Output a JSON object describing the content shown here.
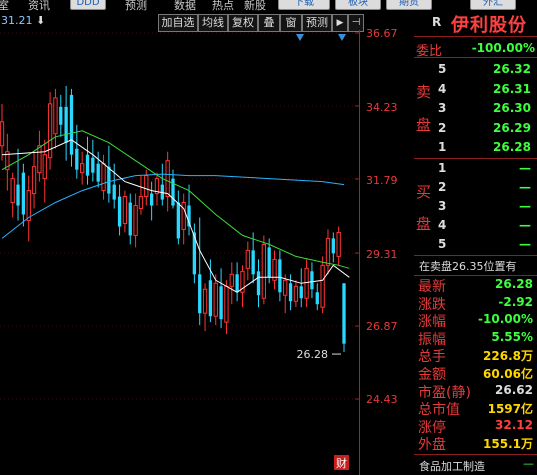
{
  "topbar": {
    "items": [
      "室",
      "资讯"
    ],
    "buttons": [
      "DDD",
      "预测",
      "数据",
      "热点",
      "新股",
      "下载",
      "板块",
      "期货",
      "外汇"
    ]
  },
  "price_label": "31.21",
  "arrow_glyph": "⬇",
  "toolbar": {
    "buttons": [
      "加自选",
      "均线",
      "复权",
      "叠",
      "窗",
      "预测"
    ],
    "play": "▶",
    "pin": "⊣"
  },
  "chart_data": {
    "type": "candlestick",
    "title": "",
    "y_ticks": [
      36.67,
      34.23,
      31.79,
      29.31,
      26.87,
      24.43
    ],
    "ylim": [
      22.7,
      37.1
    ],
    "last_close_label": "26.28",
    "bottom_marker": "财",
    "colors": {
      "up": "#ff3333",
      "down": "#28d8ff",
      "ma_short": "#ffffff",
      "ma_mid": "#3cdc3c",
      "ma_long": "#28b4ff",
      "axis": "#b01e1e"
    },
    "candles": [
      {
        "o": 32.9,
        "h": 34.3,
        "l": 32.4,
        "c": 33.7
      },
      {
        "o": 32.1,
        "h": 33.3,
        "l": 31.4,
        "c": 32.7
      },
      {
        "o": 31.0,
        "h": 32.0,
        "l": 30.5,
        "c": 31.8
      },
      {
        "o": 31.6,
        "h": 32.8,
        "l": 30.4,
        "c": 30.9
      },
      {
        "o": 32.0,
        "h": 32.3,
        "l": 30.2,
        "c": 30.6
      },
      {
        "o": 30.4,
        "h": 31.9,
        "l": 29.7,
        "c": 31.4
      },
      {
        "o": 31.3,
        "h": 32.7,
        "l": 30.8,
        "c": 32.2
      },
      {
        "o": 32.0,
        "h": 33.4,
        "l": 31.7,
        "c": 32.9
      },
      {
        "o": 31.8,
        "h": 33.1,
        "l": 31.0,
        "c": 32.6
      },
      {
        "o": 32.5,
        "h": 34.7,
        "l": 32.1,
        "c": 34.3
      },
      {
        "o": 33.3,
        "h": 34.8,
        "l": 32.8,
        "c": 34.5
      },
      {
        "o": 34.2,
        "h": 34.6,
        "l": 33.2,
        "c": 33.6
      },
      {
        "o": 34.2,
        "h": 34.9,
        "l": 32.4,
        "c": 33.0
      },
      {
        "o": 34.6,
        "h": 34.8,
        "l": 32.2,
        "c": 32.6
      },
      {
        "o": 32.8,
        "h": 33.6,
        "l": 31.8,
        "c": 32.1
      },
      {
        "o": 32.0,
        "h": 32.7,
        "l": 31.6,
        "c": 32.3
      },
      {
        "o": 32.6,
        "h": 33.2,
        "l": 31.6,
        "c": 31.9
      },
      {
        "o": 32.5,
        "h": 33.1,
        "l": 31.7,
        "c": 32.0
      },
      {
        "o": 32.3,
        "h": 32.7,
        "l": 31.5,
        "c": 31.7
      },
      {
        "o": 31.4,
        "h": 32.6,
        "l": 31.1,
        "c": 32.3
      },
      {
        "o": 32.2,
        "h": 32.9,
        "l": 31.0,
        "c": 31.3
      },
      {
        "o": 31.6,
        "h": 32.3,
        "l": 30.8,
        "c": 31.1
      },
      {
        "o": 31.2,
        "h": 31.6,
        "l": 29.9,
        "c": 30.2
      },
      {
        "o": 30.3,
        "h": 31.4,
        "l": 30.0,
        "c": 31.2
      },
      {
        "o": 31.0,
        "h": 31.3,
        "l": 29.6,
        "c": 29.9
      },
      {
        "o": 29.9,
        "h": 31.3,
        "l": 29.5,
        "c": 30.9
      },
      {
        "o": 30.8,
        "h": 31.9,
        "l": 30.6,
        "c": 31.2
      },
      {
        "o": 31.2,
        "h": 32.1,
        "l": 30.9,
        "c": 31.9
      },
      {
        "o": 31.3,
        "h": 31.7,
        "l": 30.4,
        "c": 30.9
      },
      {
        "o": 31.3,
        "h": 32.0,
        "l": 30.9,
        "c": 31.8
      },
      {
        "o": 31.6,
        "h": 32.3,
        "l": 30.9,
        "c": 31.1
      },
      {
        "o": 31.2,
        "h": 32.7,
        "l": 30.7,
        "c": 32.4
      },
      {
        "o": 31.8,
        "h": 32.1,
        "l": 30.8,
        "c": 30.9
      },
      {
        "o": 31.0,
        "h": 31.4,
        "l": 29.6,
        "c": 29.8
      },
      {
        "o": 30.1,
        "h": 31.3,
        "l": 29.6,
        "c": 31.0
      },
      {
        "o": 30.9,
        "h": 31.6,
        "l": 29.9,
        "c": 30.2
      },
      {
        "o": 30.0,
        "h": 30.3,
        "l": 28.3,
        "c": 28.6
      },
      {
        "o": 28.6,
        "h": 30.5,
        "l": 26.9,
        "c": 27.3
      },
      {
        "o": 27.3,
        "h": 28.3,
        "l": 26.7,
        "c": 28.1
      },
      {
        "o": 28.4,
        "h": 29.1,
        "l": 27.0,
        "c": 27.2
      },
      {
        "o": 27.2,
        "h": 28.6,
        "l": 26.9,
        "c": 28.3
      },
      {
        "o": 28.2,
        "h": 28.8,
        "l": 26.8,
        "c": 27.1
      },
      {
        "o": 27.0,
        "h": 28.4,
        "l": 26.6,
        "c": 28.2
      },
      {
        "o": 28.2,
        "h": 29.0,
        "l": 27.6,
        "c": 28.6
      },
      {
        "o": 28.6,
        "h": 29.0,
        "l": 27.7,
        "c": 28.0
      },
      {
        "o": 28.0,
        "h": 28.9,
        "l": 27.5,
        "c": 28.7
      },
      {
        "o": 28.8,
        "h": 29.7,
        "l": 28.4,
        "c": 29.4
      },
      {
        "o": 29.4,
        "h": 30.0,
        "l": 28.3,
        "c": 28.6
      },
      {
        "o": 28.7,
        "h": 29.1,
        "l": 27.5,
        "c": 27.9
      },
      {
        "o": 27.8,
        "h": 29.9,
        "l": 27.6,
        "c": 29.6
      },
      {
        "o": 29.5,
        "h": 29.8,
        "l": 28.3,
        "c": 28.5
      },
      {
        "o": 28.4,
        "h": 29.4,
        "l": 28.1,
        "c": 29.1
      },
      {
        "o": 29.1,
        "h": 29.4,
        "l": 27.7,
        "c": 28.0
      },
      {
        "o": 27.9,
        "h": 28.6,
        "l": 27.3,
        "c": 28.4
      },
      {
        "o": 28.3,
        "h": 28.6,
        "l": 27.4,
        "c": 27.7
      },
      {
        "o": 27.7,
        "h": 28.4,
        "l": 27.5,
        "c": 28.2
      },
      {
        "o": 28.2,
        "h": 28.8,
        "l": 27.5,
        "c": 27.8
      },
      {
        "o": 27.8,
        "h": 29.1,
        "l": 27.5,
        "c": 28.8
      },
      {
        "o": 28.7,
        "h": 29.0,
        "l": 27.8,
        "c": 28.1
      },
      {
        "o": 28.0,
        "h": 28.3,
        "l": 27.4,
        "c": 27.6
      },
      {
        "o": 27.5,
        "h": 29.2,
        "l": 27.3,
        "c": 28.9
      },
      {
        "o": 28.9,
        "h": 30.1,
        "l": 28.6,
        "c": 29.8
      },
      {
        "o": 29.8,
        "h": 30.0,
        "l": 29.0,
        "c": 29.3
      },
      {
        "o": 29.2,
        "h": 30.2,
        "l": 28.9,
        "c": 30.0
      },
      {
        "o": 28.3,
        "h": 28.3,
        "l": 26.0,
        "c": 26.28
      }
    ],
    "ma_short": [
      [
        0,
        32.6
      ],
      [
        8,
        32.7
      ],
      [
        13,
        33.1
      ],
      [
        17,
        32.6
      ],
      [
        23,
        31.7
      ],
      [
        28,
        31.4
      ],
      [
        31,
        31.3
      ],
      [
        34,
        30.8
      ],
      [
        37,
        29.4
      ],
      [
        40,
        28.4
      ],
      [
        44,
        28.0
      ],
      [
        48,
        28.5
      ],
      [
        52,
        28.5
      ],
      [
        56,
        28.3
      ],
      [
        60,
        28.4
      ],
      [
        62,
        28.9
      ],
      [
        65,
        28.5
      ]
    ],
    "ma_mid": [
      [
        0,
        32.1
      ],
      [
        5,
        32.6
      ],
      [
        10,
        33.2
      ],
      [
        15,
        33.4
      ],
      [
        20,
        33.0
      ],
      [
        25,
        32.4
      ],
      [
        30,
        31.8
      ],
      [
        35,
        31.4
      ],
      [
        40,
        30.6
      ],
      [
        45,
        29.9
      ],
      [
        50,
        29.6
      ],
      [
        55,
        29.2
      ],
      [
        60,
        29.0
      ],
      [
        63,
        28.9
      ],
      [
        65,
        28.8
      ]
    ],
    "ma_long": [
      [
        0,
        29.8
      ],
      [
        5,
        30.5
      ],
      [
        10,
        31.0
      ],
      [
        15,
        31.4
      ],
      [
        20,
        31.7
      ],
      [
        25,
        31.9
      ],
      [
        30,
        31.95
      ],
      [
        35,
        31.9
      ],
      [
        40,
        31.9
      ],
      [
        45,
        31.85
      ],
      [
        50,
        31.8
      ],
      [
        55,
        31.75
      ],
      [
        60,
        31.7
      ],
      [
        64,
        31.6
      ]
    ]
  },
  "panel": {
    "r_badge": "R",
    "stock_name": "伊利股份",
    "weibi": {
      "label": "委比",
      "value": "-100.00%"
    },
    "sell_label": [
      "卖",
      "盘"
    ],
    "sell": [
      {
        "lvl": "5",
        "price": "26.32"
      },
      {
        "lvl": "4",
        "price": "26.31"
      },
      {
        "lvl": "3",
        "price": "26.30"
      },
      {
        "lvl": "2",
        "price": "26.29"
      },
      {
        "lvl": "1",
        "price": "26.28"
      }
    ],
    "buy_label": [
      "买",
      "盘"
    ],
    "buy": [
      {
        "lvl": "1",
        "price": "—"
      },
      {
        "lvl": "2",
        "price": "—"
      },
      {
        "lvl": "3",
        "price": "—"
      },
      {
        "lvl": "4",
        "price": "—"
      },
      {
        "lvl": "5",
        "price": "—"
      }
    ],
    "status_line": "在卖盘26.35位置有",
    "stats": [
      {
        "label": "最新",
        "value": "26.28",
        "cls": "num"
      },
      {
        "label": "涨跌",
        "value": "-2.92",
        "cls": "num"
      },
      {
        "label": "涨幅",
        "value": "-10.00%",
        "cls": "num"
      },
      {
        "label": "振幅",
        "value": "5.55%",
        "cls": "num"
      },
      {
        "label": "总手",
        "value": "226.8万",
        "cls": "yel"
      },
      {
        "label": "金额",
        "value": "60.06亿",
        "cls": "yel"
      },
      {
        "label": "市盈(静)",
        "value": "26.62",
        "cls": "wht"
      },
      {
        "label": "总市值",
        "value": "1597亿",
        "cls": "yel"
      },
      {
        "label": "涨停",
        "value": "32.12",
        "cls": "red"
      },
      {
        "label": "外盘",
        "value": "155.1万",
        "cls": "yel"
      }
    ],
    "industry": "食品加工制造",
    "industry_tail": "—"
  }
}
